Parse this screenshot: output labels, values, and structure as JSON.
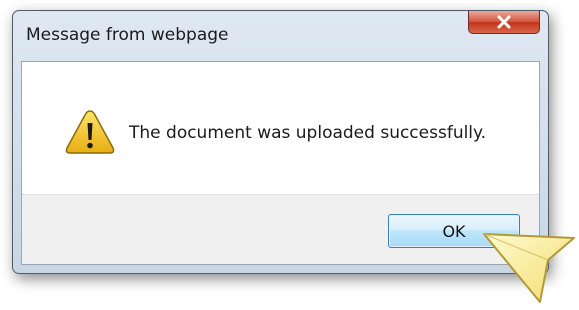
{
  "window": {
    "title": "Message from webpage",
    "close_icon": "close-x-icon"
  },
  "dialog": {
    "icon": "warning-triangle-icon",
    "message": "The document was uploaded successfully.",
    "ok_label": "OK"
  },
  "colors": {
    "close_button": "#c9442c",
    "ok_button_border": "#3c7fb1",
    "warning_yellow": "#f5c623",
    "cursor_yellow": "#fff3a8"
  }
}
